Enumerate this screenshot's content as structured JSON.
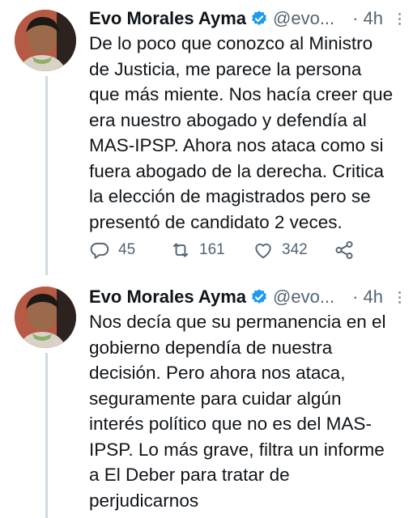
{
  "tweets": [
    {
      "author_name": "Evo Morales Ayma",
      "handle": "@evo...",
      "separator": "·",
      "time": "4h",
      "text": "De lo poco que conozco al Ministro\nde Justicia, me parece la persona\nque más miente. Nos hacía creer que\nera nuestro abogado y defendía al\nMAS-IPSP. Ahora nos ataca como si\nfuera abogado de la derecha. Critica\nla elección de magistrados pero se\npresentó de candidato 2 veces.",
      "replies": "45",
      "retweets": "161",
      "likes": "342"
    },
    {
      "author_name": "Evo Morales Ayma",
      "handle": "@evo...",
      "separator": "·",
      "time": "4h",
      "text": "Nos decía que su permanencia en el\ngobierno dependía de nuestra\ndecisión. Pero ahora nos ataca,\nseguramente para cuidar algún\ninterés político que no es del MAS-\nIPSP. Lo más grave, filtra un informe\na El Deber para tratar de\nperjudicarnos"
    }
  ],
  "icons": {
    "verified": "verified-badge-icon",
    "reply": "reply-icon",
    "retweet": "retweet-icon",
    "like": "heart-icon",
    "share": "share-icon",
    "more": "more-options-icon"
  },
  "colors": {
    "text": "#0f1419",
    "secondary": "#536471",
    "verified": "#1d9bf0",
    "thread_line": "#cfd9de"
  }
}
